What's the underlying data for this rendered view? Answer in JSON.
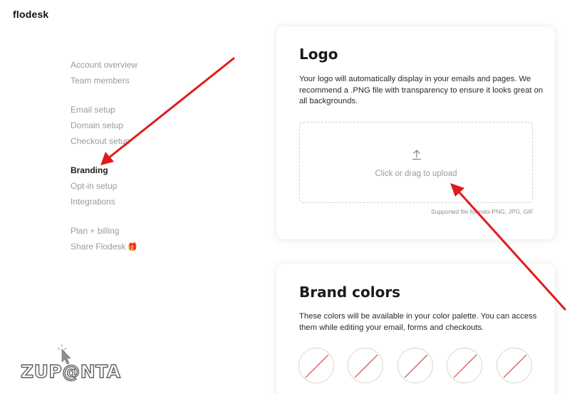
{
  "app": {
    "brand": "flodesk"
  },
  "sidebar": {
    "items": [
      {
        "label": "Account overview",
        "active": false
      },
      {
        "label": "Team members",
        "active": false
      },
      {
        "label": "Email setup",
        "active": false
      },
      {
        "label": "Domain setup",
        "active": false
      },
      {
        "label": "Checkout setup",
        "active": false
      },
      {
        "label": "Branding",
        "active": true
      },
      {
        "label": "Opt-in setup",
        "active": false
      },
      {
        "label": "Integrations",
        "active": false
      },
      {
        "label": "Plan + billing",
        "active": false
      },
      {
        "label": "Share Flodesk",
        "active": false,
        "emoji": "🎁"
      }
    ]
  },
  "logo_card": {
    "title": "Logo",
    "description": "Your logo will automatically display in your emails and pages. We recommend a .PNG file with transparency to ensure it looks great on all backgrounds.",
    "upload_label": "Click or drag to upload",
    "upload_icon": "upload-arrow-icon",
    "formats_note": "Supported file formats PNG, JPG, GIF"
  },
  "brand_colors_card": {
    "title": "Brand colors",
    "description": "These colors will be available in your color palette. You can access them while editing your email, forms and checkouts.",
    "swatch_count": 5,
    "swatch_state": "empty"
  },
  "annotations": {
    "arrow_color": "#e01b1b"
  },
  "watermark": {
    "text": "ZUPONTA"
  }
}
